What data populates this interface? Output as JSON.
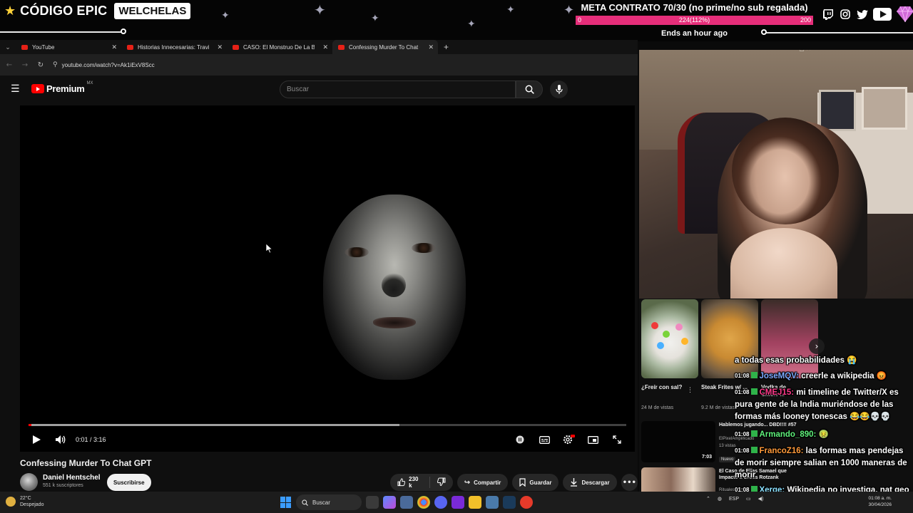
{
  "overlay": {
    "brand_left": "CÓDIGO EPIC",
    "brand_right": "WELCHELAS",
    "goal_title": "META CONTRATO 70/30 (no prime/no sub regalada)",
    "goal_min": "0",
    "goal_current": "224(112%)",
    "goal_max": "200",
    "goal_fill": 1.0,
    "goal_ends": "Ends an hour ago",
    "socials": [
      "twitch-icon",
      "instagram-icon",
      "twitter-icon",
      "youtube-icon"
    ]
  },
  "browser": {
    "tabs": [
      {
        "title": "YouTube"
      },
      {
        "title": "Historias Innecesarias: Travis el"
      },
      {
        "title": "CASO: El Monstruo De La Biciclet"
      },
      {
        "title": "Confessing Murder To Chat GPT"
      }
    ],
    "active_tab": 3,
    "url": "youtube.com/watch?v=Ak1iExV8Scc"
  },
  "youtube": {
    "logo_label": "Premium",
    "logo_region": "MX",
    "search_placeholder": "Buscar",
    "player": {
      "time": "0:01 / 3:16",
      "progress_fraction": 0.005,
      "buffered_fraction": 0.62
    },
    "video_title": "Confessing Murder To Chat GPT",
    "channel_name": "Daniel Hentschel",
    "channel_subs": "551 k suscriptores",
    "subscribe_label": "Suscribirse",
    "likes": "230 k",
    "share_label": "Compartir",
    "save_label": "Guardar",
    "download_label": "Descargar"
  },
  "recommendations": {
    "shorts": [
      {
        "title": "¿Freír con sal?",
        "views": "24 M de vistas"
      },
      {
        "title": "Steak Frites w/ ...",
        "views": "9.2 M de vistas"
      },
      {
        "title": "Vodka de Chicle ...",
        "views": ""
      }
    ],
    "videos": [
      {
        "title": "Hablemos jugando... DBD!!!! #57",
        "channel": "ElPixelAmplificado",
        "meta": "13 vistas",
        "badge": "Nuevo",
        "duration": "7:03"
      },
      {
        "title": "El Caso de Elías Samael que Impactó a Dross Rotzank",
        "channel": "Rituales...",
        "meta": "",
        "badge": "",
        "duration": ""
      }
    ]
  },
  "chat": [
    {
      "time": "",
      "user": "",
      "color": "#ffffff",
      "text": "a todas esas probabilidades 😭"
    },
    {
      "time": "01:08",
      "user": "JoseMQV:",
      "color": "#7da9ff",
      "text": " creerle a wikipedia 😡"
    },
    {
      "time": "01:08",
      "user": "CMEJ15:",
      "color": "#ff3a8a",
      "text": " mi timeline de Twitter/X es pura gente de la India muriéndose de las formas más looney tonescas 😂😂💀💀"
    },
    {
      "time": "01:08",
      "user": "Armando_890:",
      "color": "#5ef07a",
      "text": " 🤢"
    },
    {
      "time": "01:08",
      "user": "FrancoZ16:",
      "color": "#ff9a3a",
      "text": " las formas mas pendejas de morir siempre salian en 1000 maneras de morir"
    },
    {
      "time": "01:08",
      "user": "Xerge:",
      "color": "#8be0ff",
      "text": " Wikipedia no investiga, nat geo si"
    }
  ],
  "taskbar": {
    "temp": "22°C",
    "weather": "Despejado",
    "search_label": "Buscar",
    "lang": "ESP",
    "time": "01:08 a. m.",
    "date": "30/04/2026"
  }
}
